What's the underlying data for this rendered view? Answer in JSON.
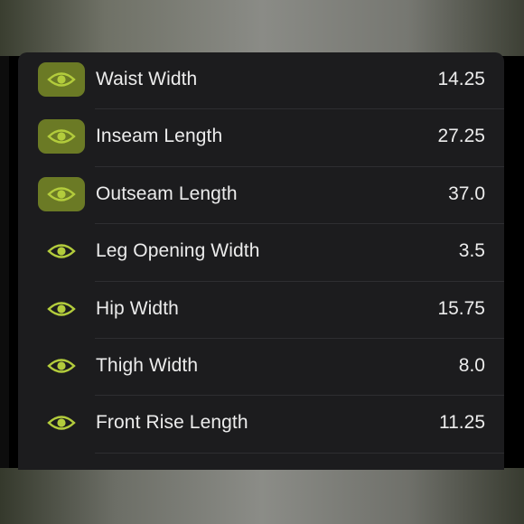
{
  "accent_color": "#b3cc3c",
  "active_bg_color": "#6b7a25",
  "rows": [
    {
      "label": "Waist Width",
      "value": "14.25",
      "active": true,
      "icon": "eye-icon"
    },
    {
      "label": "Inseam Length",
      "value": "27.25",
      "active": true,
      "icon": "eye-icon"
    },
    {
      "label": "Outseam Length",
      "value": "37.0",
      "active": true,
      "icon": "eye-icon"
    },
    {
      "label": "Leg Opening Width",
      "value": "3.5",
      "active": false,
      "icon": "eye-icon"
    },
    {
      "label": "Hip Width",
      "value": "15.75",
      "active": false,
      "icon": "eye-icon"
    },
    {
      "label": "Thigh Width",
      "value": "8.0",
      "active": false,
      "icon": "eye-icon"
    },
    {
      "label": "Front Rise Length",
      "value": "11.25",
      "active": false,
      "icon": "eye-icon"
    }
  ]
}
